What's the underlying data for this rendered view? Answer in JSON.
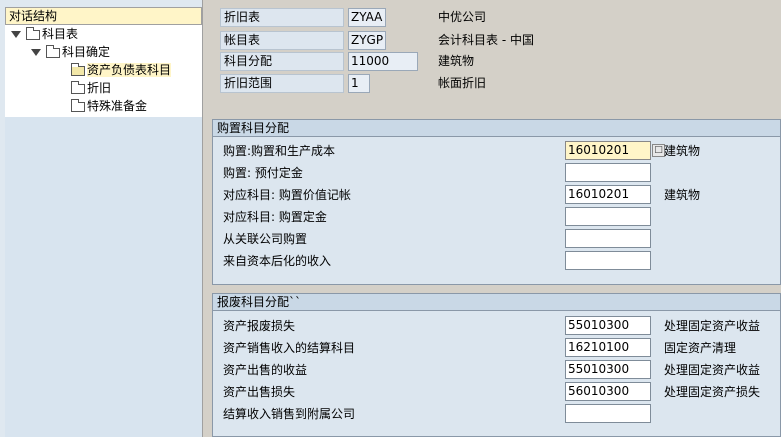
{
  "tree": {
    "title": "对话结构",
    "nodes": [
      {
        "label": "科目表"
      },
      {
        "label": "科目确定"
      },
      {
        "label": "资产负债表科目"
      },
      {
        "label": "折旧"
      },
      {
        "label": "特殊准备金"
      }
    ]
  },
  "header": {
    "rows": [
      {
        "label": "折旧表",
        "value": "ZYAA",
        "desc": "中优公司"
      },
      {
        "label": "帐目表",
        "value": "ZYGP",
        "desc": "会计科目表 - 中国"
      },
      {
        "label": "科目分配",
        "value": "11000",
        "desc": "建筑物"
      },
      {
        "label": "折旧范围",
        "value": "1",
        "desc": "帐面折旧"
      }
    ]
  },
  "acquisition": {
    "title": "购置科目分配",
    "rows": [
      {
        "label": "购置:购置和生产成本",
        "value": "16010201",
        "desc": "建筑物"
      },
      {
        "label": "购置: 预付定金",
        "value": "",
        "desc": ""
      },
      {
        "label": "对应科目: 购置价值记帐",
        "value": "16010201",
        "desc": "建筑物"
      },
      {
        "label": "对应科目: 购置定金",
        "value": "",
        "desc": ""
      },
      {
        "label": "从关联公司购置",
        "value": "",
        "desc": ""
      },
      {
        "label": "来自资本后化的收入",
        "value": "",
        "desc": ""
      }
    ]
  },
  "retirement": {
    "title": "报废科目分配``",
    "rows": [
      {
        "label": "资产报废损失",
        "value": "55010300",
        "desc": "处理固定资产收益"
      },
      {
        "label": "资产销售收入的结算科目",
        "value": "16210100",
        "desc": "固定资产清理"
      },
      {
        "label": "资产出售的收益",
        "value": "55010300",
        "desc": "处理固定资产收益"
      },
      {
        "label": "资产出售损失",
        "value": "56010300",
        "desc": "处理固定资产损失"
      },
      {
        "label": "结算收入销售到附属公司",
        "value": "",
        "desc": ""
      }
    ]
  },
  "icons": {
    "search_help": "search-help-icon",
    "folder": "folder-icon",
    "expand": "expand-triangle-icon"
  }
}
